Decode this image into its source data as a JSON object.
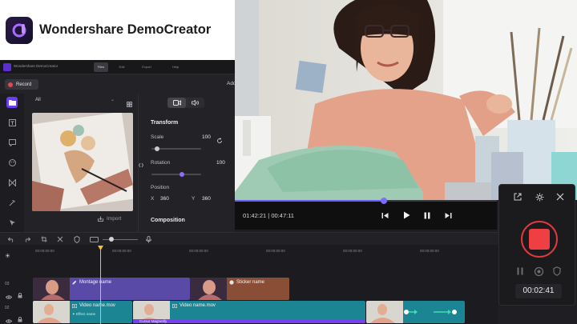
{
  "brand": {
    "title": "Wondershare DemoCreator"
  },
  "app": {
    "window_title": "Wondershare DemoCreator",
    "tabs": [
      "Files",
      "Edit",
      "Export",
      "Help"
    ],
    "record_label": "Record",
    "overflow_label": "Add",
    "media": {
      "filter": "All",
      "import_label": "Import"
    },
    "props": {
      "transform_heading": "Transform",
      "scale_label": "Scale",
      "scale_value": "100",
      "rotation_label": "Rotation",
      "rotation_value": "100",
      "position_label": "Position",
      "x_label": "X",
      "x_value": "360",
      "y_label": "Y",
      "y_value": "360",
      "composition_heading": "Composition"
    }
  },
  "player": {
    "current_time": "01:42:21",
    "total_time": "00:47:11",
    "progress": 0.57
  },
  "recorder": {
    "elapsed": "00:02:41"
  },
  "timeline": {
    "ruler": [
      "00:00:00:00",
      "00:00:00:00",
      "00:00:00:00",
      "00:00:00:00",
      "00:00:00:00",
      "00:00:00:00"
    ],
    "tracks": [
      {
        "num": "03",
        "clips": [
          {
            "label": "Montage name",
            "color": "#5a4aa8"
          },
          {
            "label": "Sticker name",
            "color": "#8a4e36"
          }
        ]
      },
      {
        "num": "02",
        "clips": [
          {
            "label": "Video name.mov",
            "sub": "Effect name",
            "color": "#1c8593"
          },
          {
            "label": "Video name.mov",
            "sub": "Cursor Magnetify",
            "color": "#1c8593"
          }
        ]
      }
    ]
  },
  "colors": {
    "accent": "#6b3ff0",
    "record_red": "#ef3f43",
    "playhead": "#f3c021"
  }
}
